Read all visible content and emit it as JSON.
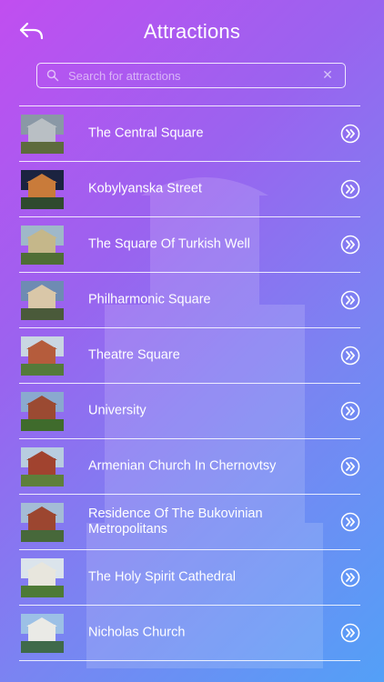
{
  "header": {
    "title": "Attractions",
    "back_icon": "back-arrow-icon"
  },
  "search": {
    "placeholder": "Search for attractions",
    "value": "",
    "icon": "search-icon",
    "clear_icon": "close-icon"
  },
  "attractions": [
    {
      "name": "The Central Square",
      "thumb": [
        "#8a98a6",
        "#b9bfc4",
        "#5d6b3d"
      ]
    },
    {
      "name": "Kobylyanska Street",
      "thumb": [
        "#1b2340",
        "#c97b3a",
        "#2f4a2e"
      ]
    },
    {
      "name": "The Square Of Turkish Well",
      "thumb": [
        "#9fb8c9",
        "#c5b78a",
        "#4f6e35"
      ]
    },
    {
      "name": "Philharmonic Square",
      "thumb": [
        "#6e8bb3",
        "#d9c7a8",
        "#4a5a3a"
      ]
    },
    {
      "name": "Theatre Square",
      "thumb": [
        "#c9d6e2",
        "#b55c3c",
        "#547a3a"
      ]
    },
    {
      "name": "University",
      "thumb": [
        "#8aa9cf",
        "#9b4a32",
        "#3f6b2c"
      ]
    },
    {
      "name": "Armenian Church In Chernovtsy",
      "thumb": [
        "#b8cde0",
        "#a1432f",
        "#5e7f3b"
      ]
    },
    {
      "name": "Residence Of The Bukovinian Metropolitans",
      "thumb": [
        "#a4bcd6",
        "#9c4630",
        "#47683a"
      ]
    },
    {
      "name": "The Holy Spirit Cathedral",
      "thumb": [
        "#dbe4ec",
        "#e8e6dd",
        "#4d7a36"
      ]
    },
    {
      "name": "Nicholas Church",
      "thumb": [
        "#9cc0e6",
        "#eaeae6",
        "#3f6a4a"
      ]
    }
  ],
  "row_action_icon": "chevron-double-right-icon"
}
